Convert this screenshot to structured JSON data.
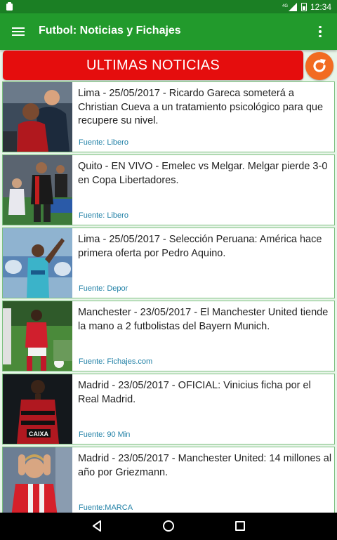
{
  "status_bar": {
    "time": "12:34",
    "network": "4G"
  },
  "app_bar": {
    "title": "Futbol: Noticias y Fichajes"
  },
  "news_header": {
    "label": "ULTIMAS NOTICIAS"
  },
  "articles": [
    {
      "text": "Lima - 25/05/2017 - Ricardo Gareca someterá a Christian Cueva a un tratamiento psicológico para que recupere su nivel.",
      "source": "Fuente: Libero"
    },
    {
      "text": "Quito - EN VIVO - Emelec vs Melgar.  Melgar pierde 3-0 en Copa Libertadores.",
      "source": "Fuente: Libero"
    },
    {
      "text": "Lima - 25/05/2017 - Selección Peruana: América hace primera oferta por Pedro Aquino.",
      "source": "Fuente: Depor"
    },
    {
      "text": "Manchester - 23/05/2017 - El Manchester United tiende la mano a 2 futbolistas del Bayern Munich.",
      "source": "Fuente: Fichajes.com"
    },
    {
      "text": "Madrid - 23/05/2017 - OFICIAL: Vinicius ficha por el Real Madrid.",
      "source": "Fuente: 90 Min"
    },
    {
      "text": "Madrid - 23/05/2017 - Manchester United: 14 millones al año por Griezmann.",
      "source": "Fuente:MARCA"
    }
  ],
  "thumb_labels": {
    "sponsor": "CAIXA"
  }
}
